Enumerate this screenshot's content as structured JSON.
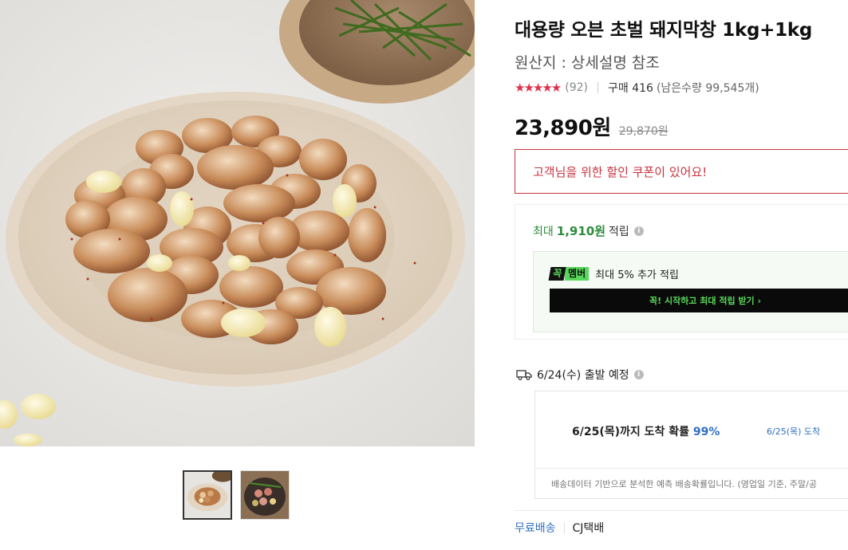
{
  "product": {
    "title": "대용량 오븐 초벌 돼지막창 1kg+1kg",
    "origin": "원산지 : 상세설명 참조",
    "stars": "★★★★★",
    "review_count": "(92)",
    "purchase": "구매 416",
    "remaining": "(남은수량 99,545개)",
    "price": "23,890원",
    "original_price": "29,870원"
  },
  "coupon": {
    "label": "고객님을 위한 할인 쿠폰이 있어요!"
  },
  "points": {
    "prefix": "최대",
    "amount": "1,910원",
    "suffix": "적립",
    "info_icon": "i"
  },
  "membership": {
    "badge_part1": "꼭",
    "badge_part2": "멤버",
    "text": "최대 5% 추가 적립",
    "button_label": "꼭! 시작하고 최대 적립 받기 ›"
  },
  "shipping": {
    "departure": "6/24(수) 출발 예정",
    "info_icon": "i",
    "arrival_text": "6/25(목)까지 도착 확률",
    "arrival_pct": "99%",
    "bar_label": "6/25(목) 도착",
    "note": "배송데이터 기반으로 분석한 예측 배송확률입니다. (영업일 기준, 주말/공",
    "free_shipping": "무료배송",
    "courier": "CJ택배"
  },
  "colors": {
    "accent_red": "#c9343f",
    "star_red": "#e0314a",
    "point_green": "#2e8b3c",
    "member_green": "#57d85a",
    "link_blue": "#2f6fc0"
  },
  "icons": [
    "info-icon",
    "truck-icon",
    "star-icon"
  ]
}
